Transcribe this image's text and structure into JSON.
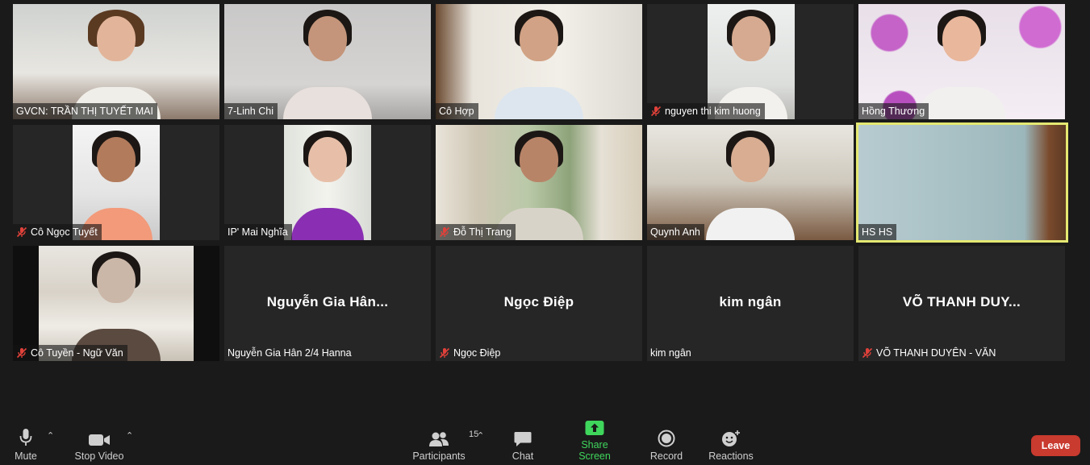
{
  "participants": [
    {
      "label": "GVCN: TRẦN THỊ TUYẾT MAI",
      "muted": false
    },
    {
      "label": "7-Linh Chi",
      "muted": false
    },
    {
      "label": "Cô Hợp",
      "muted": false
    },
    {
      "label": "nguyen thi kim huong",
      "muted": true
    },
    {
      "label": "Hồng Thương",
      "muted": false
    },
    {
      "label": "Cô Ngọc Tuyết",
      "muted": true
    },
    {
      "label": "IP' Mai Nghĩa",
      "muted": false
    },
    {
      "label": "Đỗ Thị Trang",
      "muted": true
    },
    {
      "label": "Quynh Anh",
      "muted": false
    },
    {
      "label": "HS HS",
      "muted": false
    },
    {
      "label": "Cô Tuyền - Ngữ Văn",
      "muted": true
    },
    {
      "label": "Nguyễn Gia Hân 2/4 Hanna",
      "muted": false,
      "display_name": "Nguyễn Gia Hân..."
    },
    {
      "label": "Ngọc Điệp",
      "muted": true,
      "display_name": "Ngọc Điệp"
    },
    {
      "label": "kim ngân",
      "muted": false,
      "display_name": "kim ngân"
    },
    {
      "label": "VÕ THANH DUYÊN - VĂN",
      "muted": true,
      "display_name": "VÕ THANH DUY..."
    }
  ],
  "toolbar": {
    "mute": "Mute",
    "stop_video": "Stop Video",
    "participants": "Participants",
    "participants_count": "15",
    "chat": "Chat",
    "share_screen": "Share Screen",
    "record": "Record",
    "reactions": "Reactions",
    "leave": "Leave"
  },
  "colors": {
    "active_speaker": "#e4e872",
    "share_green": "#3fd65c",
    "leave_red": "#c93a2f",
    "muted_red": "#e0413a"
  }
}
